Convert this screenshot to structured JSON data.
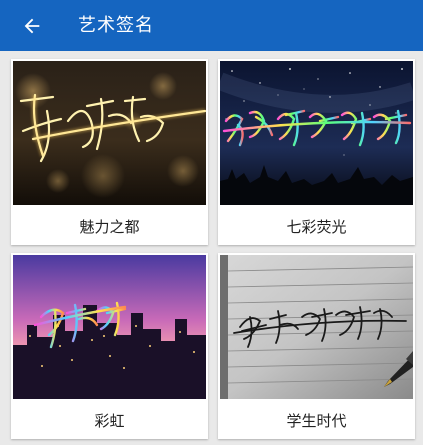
{
  "header": {
    "back_icon": "arrow-left-icon",
    "title": "艺术签名",
    "background": "#1565c0"
  },
  "cards": [
    {
      "label": "魅力之都",
      "image": "night-city-signature"
    },
    {
      "label": "七彩荧光",
      "image": "starry-sky-signature"
    },
    {
      "label": "彩虹",
      "image": "purple-city-signature"
    },
    {
      "label": "学生时代",
      "image": "notebook-signature"
    }
  ]
}
